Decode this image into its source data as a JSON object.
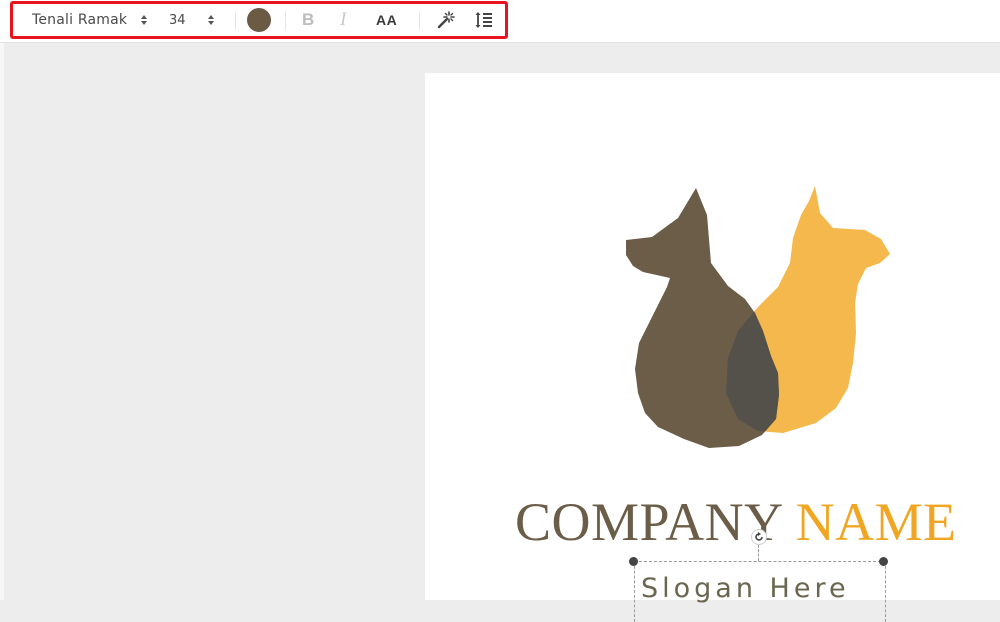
{
  "toolbar": {
    "font_family": "Tenali Ramak",
    "font_size": "34",
    "text_color": "#6b5b45",
    "bold_label": "B",
    "italic_label": "I",
    "case_label": "AA",
    "magic_icon": "magic-wand-icon",
    "spacing_icon": "line-spacing-icon",
    "highlight_color": "#e8131d"
  },
  "canvas": {
    "company_name_part1": "COMPANY",
    "company_name_part2": "NAME",
    "slogan": "Slogan Here",
    "colors": {
      "dog": "#6b5d47",
      "cat": "#f5b84c",
      "overlap": "#53514a",
      "name_dark": "#6b5d47",
      "name_accent": "#f0a623"
    }
  }
}
